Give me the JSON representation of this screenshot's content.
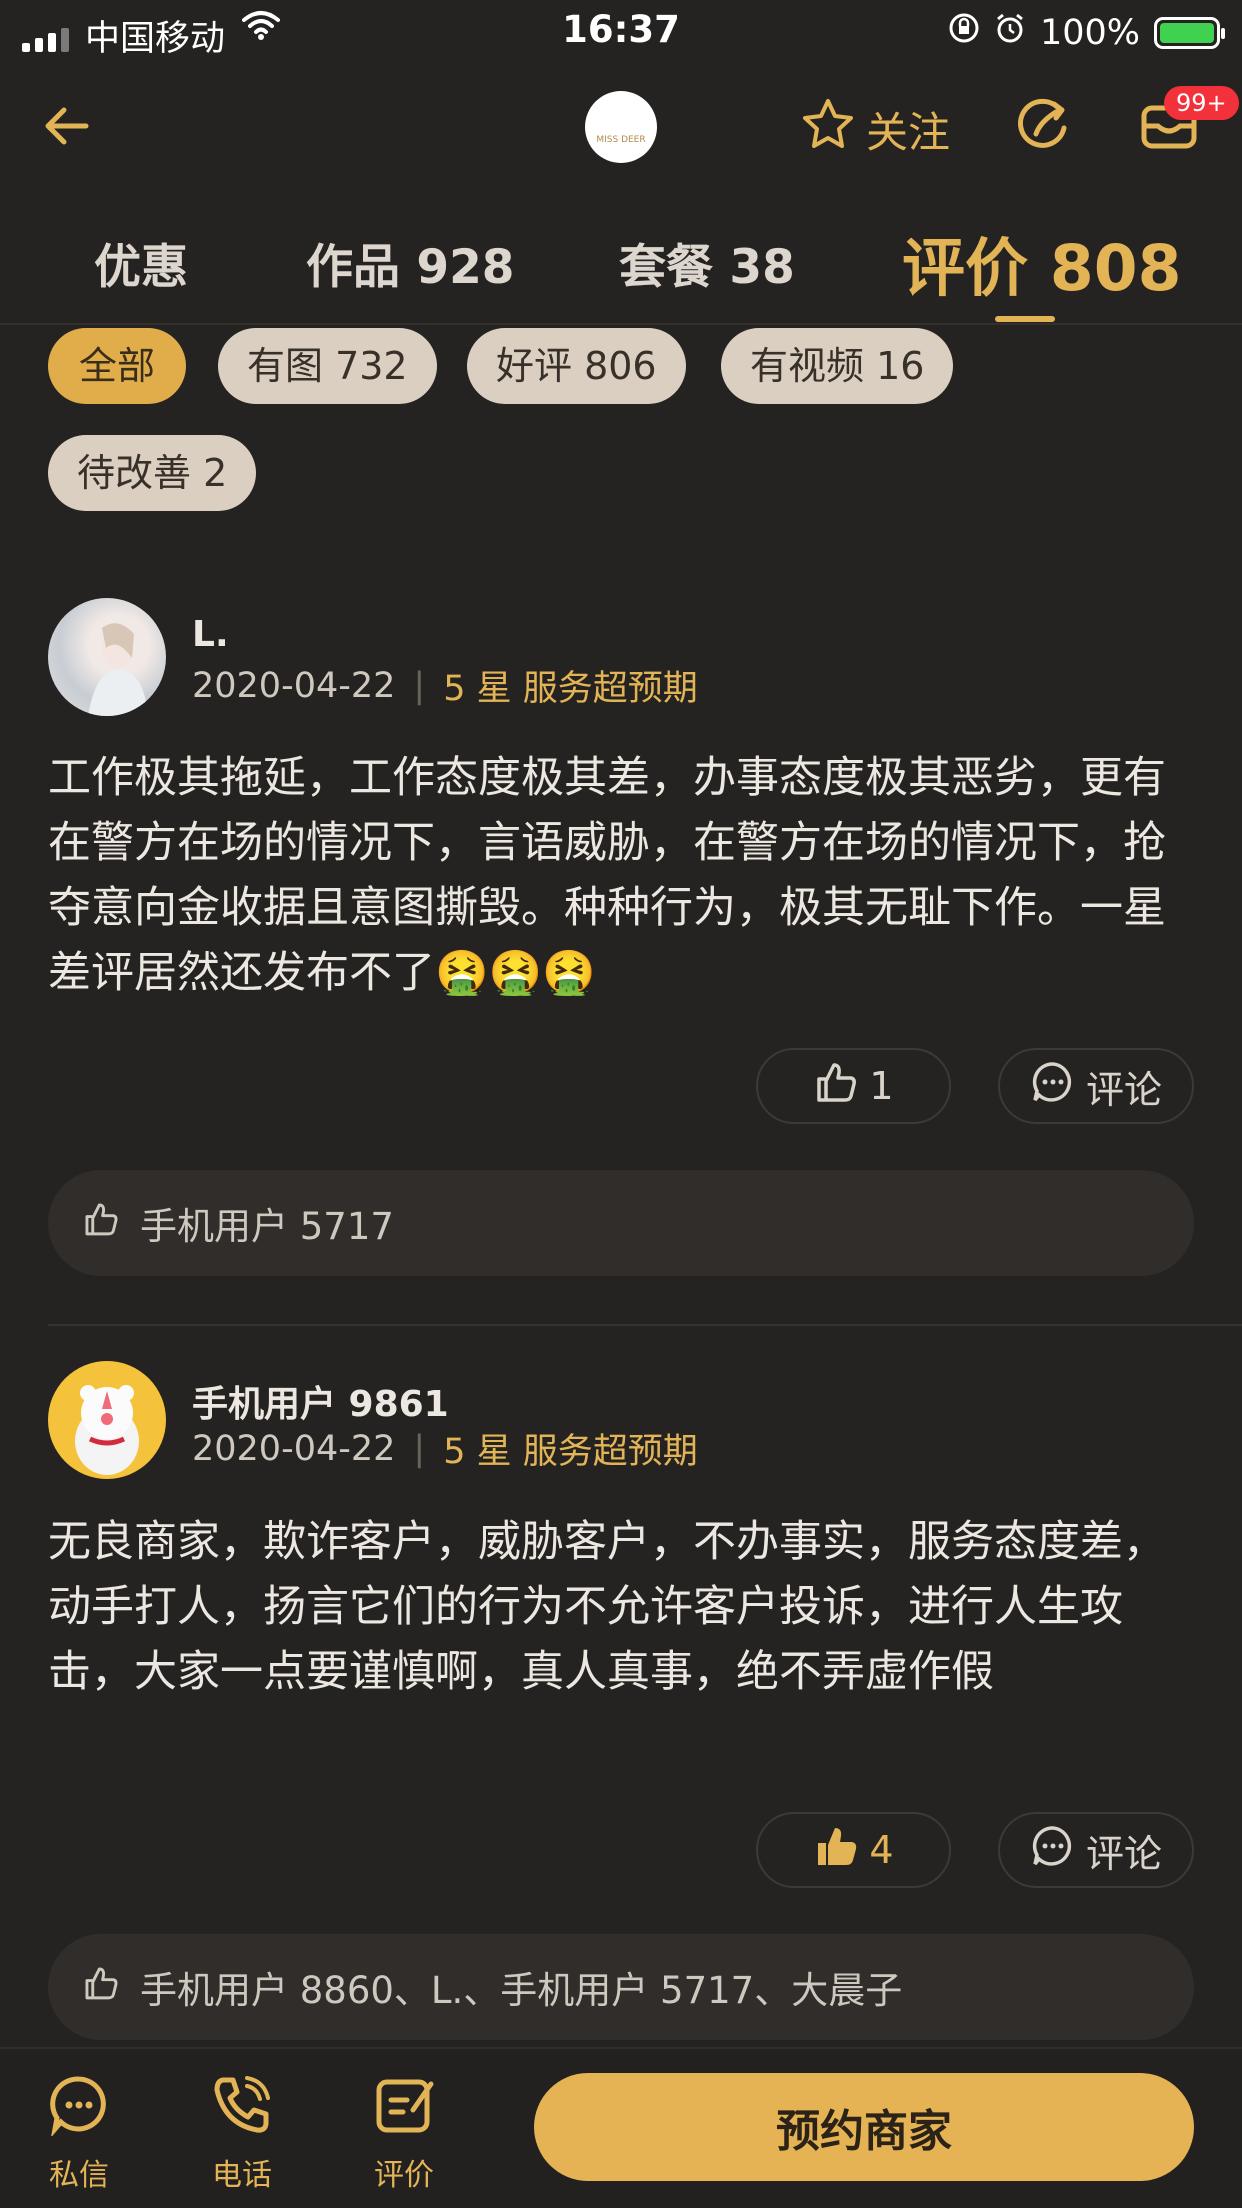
{
  "status_bar": {
    "carrier": "中国移动",
    "time": "16:37",
    "battery": "100%"
  },
  "nav": {
    "logo_text": "MISS DEER",
    "follow_label": "关注",
    "badge": "99+"
  },
  "tabs": [
    {
      "label": "优惠",
      "active": false
    },
    {
      "label": "作品 928",
      "active": false
    },
    {
      "label": "套餐 38",
      "active": false
    },
    {
      "label": "评价 808",
      "active": true
    }
  ],
  "filters": [
    {
      "label": "全部",
      "active": true
    },
    {
      "label": "有图 732",
      "active": false
    },
    {
      "label": "好评 806",
      "active": false
    },
    {
      "label": "有视频 16",
      "active": false
    },
    {
      "label": "待改善 2",
      "active": false
    }
  ],
  "reviews": [
    {
      "user": "L.",
      "date": "2020-04-22",
      "rating": "5 星 服务超预期",
      "text": "工作极其拖延，工作态度极其差，办事态度极其恶劣，更有在警方在场的情况下，言语威胁，在警方在场的情况下，抢夺意向金收据且意图撕毁。种种行为，极其无耻下作。一星差评居然还发布不了🤮🤮🤮",
      "likes": "1",
      "comment_label": "评论",
      "liked_by": "手机用户 5717"
    },
    {
      "user": "手机用户 9861",
      "date": "2020-04-22",
      "rating": "5 星 服务超预期",
      "text": "无良商家，欺诈客户，威胁客户，不办事实，服务态度差，动手打人，扬言它们的行为不允许客户投诉，进行人生攻击，大家一点要谨慎啊，真人真事，绝不弄虚作假",
      "likes": "4",
      "comment_label": "评论",
      "liked_by": "手机用户 8860、L.、手机用户 5717、大晨子"
    }
  ],
  "bottom_bar": {
    "message": "私信",
    "phone": "电话",
    "review": "评价",
    "book": "预约商家"
  },
  "colors": {
    "accent": "#e3b456",
    "background": "#252321",
    "chip": "#dbcfc1"
  }
}
